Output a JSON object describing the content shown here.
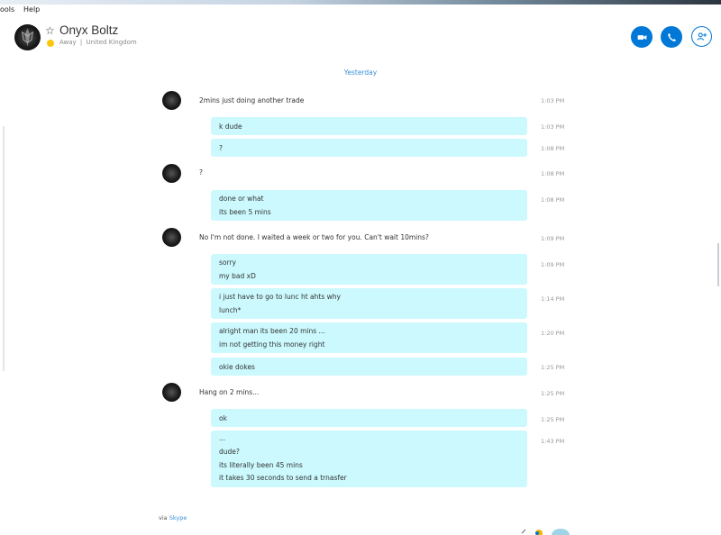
{
  "menu": {
    "tools": "ools",
    "help": "Help"
  },
  "contact": {
    "name": "Onyx Boltz",
    "status": "Away",
    "separator": "|",
    "location": "United Kingdom"
  },
  "header_buttons": {
    "video": "video-call",
    "audio": "audio-call",
    "add": "add-people"
  },
  "date_separator": "Yesterday",
  "messages": [
    {
      "sender": "them",
      "time": "1:03 PM",
      "lines": [
        "2mins just doing another trade"
      ]
    },
    {
      "sender": "me",
      "time": "1:03 PM",
      "lines": [
        "k dude"
      ]
    },
    {
      "sender": "me",
      "time": "1:08 PM",
      "lines": [
        "?"
      ]
    },
    {
      "sender": "them",
      "time": "1:08 PM",
      "lines": [
        "?"
      ]
    },
    {
      "sender": "me",
      "time": "1:08 PM",
      "lines": [
        "done or what",
        "its been 5 mins"
      ]
    },
    {
      "sender": "them",
      "time": "1:09 PM",
      "lines": [
        "No I'm not done. I waited a week or two for you. Can't wait 10mins?"
      ]
    },
    {
      "sender": "me",
      "time": "1:09 PM",
      "lines": [
        "sorry",
        "my bad xD"
      ]
    },
    {
      "sender": "me",
      "time": "1:14 PM",
      "lines": [
        "i just have to go to lunc ht ahts why",
        "lunch*"
      ]
    },
    {
      "sender": "me",
      "time": "1:20 PM",
      "lines": [
        "alright man its been 20 mins ...",
        "im not getting this money right"
      ]
    },
    {
      "sender": "me",
      "time": "1:25 PM",
      "lines": [
        "okie dokes"
      ]
    },
    {
      "sender": "them",
      "time": "1:25 PM",
      "lines": [
        "Hang on 2 mins..."
      ]
    },
    {
      "sender": "me",
      "time": "1:25 PM",
      "lines": [
        "ok"
      ]
    },
    {
      "sender": "me",
      "time": "1:43 PM",
      "lines": [
        "...",
        "dude?",
        "its literally been 45 mins",
        "it takes 30 seconds to send a trnasfer"
      ]
    }
  ],
  "footer": {
    "via": "via",
    "link": "Skype"
  },
  "colors": {
    "accent": "#0078d7",
    "bubble": "#cbf9fd",
    "away": "#f9c80e",
    "link": "#3b8fd6"
  }
}
